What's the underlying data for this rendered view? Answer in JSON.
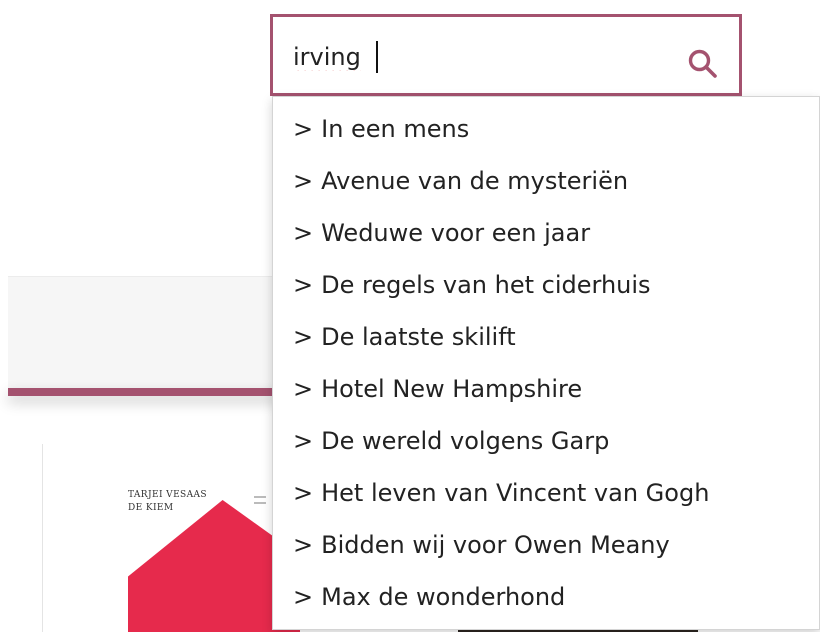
{
  "search": {
    "value": "irving",
    "icon": "search-icon",
    "icon_color": "#a4526f",
    "border_color": "#a4526f"
  },
  "suggestions": {
    "prefix": ">",
    "items": [
      {
        "label": "In een mens"
      },
      {
        "label": "Avenue van de mysteriën"
      },
      {
        "label": "Weduwe voor een jaar"
      },
      {
        "label": "De regels van het ciderhuis"
      },
      {
        "label": "De laatste skilift"
      },
      {
        "label": "Hotel New Hampshire"
      },
      {
        "label": "De wereld volgens Garp"
      },
      {
        "label": "Het leven van Vincent van Gogh"
      },
      {
        "label": "Bidden wij voor Owen Meany"
      },
      {
        "label": "Max de wonderhond"
      }
    ]
  },
  "background": {
    "accent_color": "#a4526f",
    "book": {
      "author": "TARJEI VESAAS",
      "title": "DE KIEM",
      "cover_color": "#e62a4c"
    }
  }
}
